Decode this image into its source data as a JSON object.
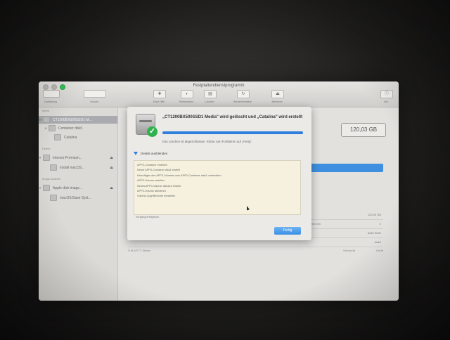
{
  "window": {
    "title": "Festplattendienstprogramm"
  },
  "toolbar": {
    "darstellung_label": "Darstellung",
    "volume_label": "Volume",
    "erste_hilfe_label": "Erste Hilfe",
    "partitionieren_label": "Partitionieren",
    "loeschen_label": "Löschen",
    "wiederherstellen_label": "Wiederherstellen",
    "aktivieren_label": "Aktivieren",
    "info_label": "Info"
  },
  "sidebar": {
    "section_intern": "Intern",
    "section_extern": "Extern",
    "section_images": "Image-Dateien",
    "items": [
      {
        "label": "CT1200BX500SSD1 M..."
      },
      {
        "label": "Container disk1"
      },
      {
        "label": "Catalina"
      },
      {
        "label": "Intenso Premium..."
      },
      {
        "label": "Install macOS..."
      },
      {
        "label": "Apple disk image..."
      },
      {
        "label": "macOS Base Syst..."
      }
    ]
  },
  "main": {
    "capacity": "120,03 GB",
    "info_rows": [
      "120,03 GB",
      "2",
      "Solid State",
      "disk0"
    ],
    "info_left_label": "Partitionen",
    "bottom_row": [
      "S.M.A.R.T.-Status",
      "Überprüft",
      "Gerät"
    ]
  },
  "dialog": {
    "title": "„CT1200BX500SSD1 Media\" wird gelöscht und „Catalina\" wird erstellt",
    "progress": 1.0,
    "message": "Das Löschen ist abgeschlossen. Klicke zum Fortfahren auf „Fertig\".",
    "details_toggle": "Details ausblenden",
    "log_lines": [
      "APFS-Container erstellen",
      "Neuer APFS-Container disk1 erstellt",
      "Hinzufügen des APFS-Volumes zum APFS-Container disk1 vorbereiten",
      "APFS-Volume erstellen",
      "Neues APFS-Volume disk1s1 erstellt",
      "APFS-Volume aktivieren",
      "Volume-Zugriffsrechte einstellen"
    ],
    "log_footer": "Vorgang erfolgreich.",
    "done_button": "Fertig"
  },
  "colors": {
    "accent": "#2f7fde",
    "success": "#2fb24b",
    "log_background": "#f5f1de"
  }
}
